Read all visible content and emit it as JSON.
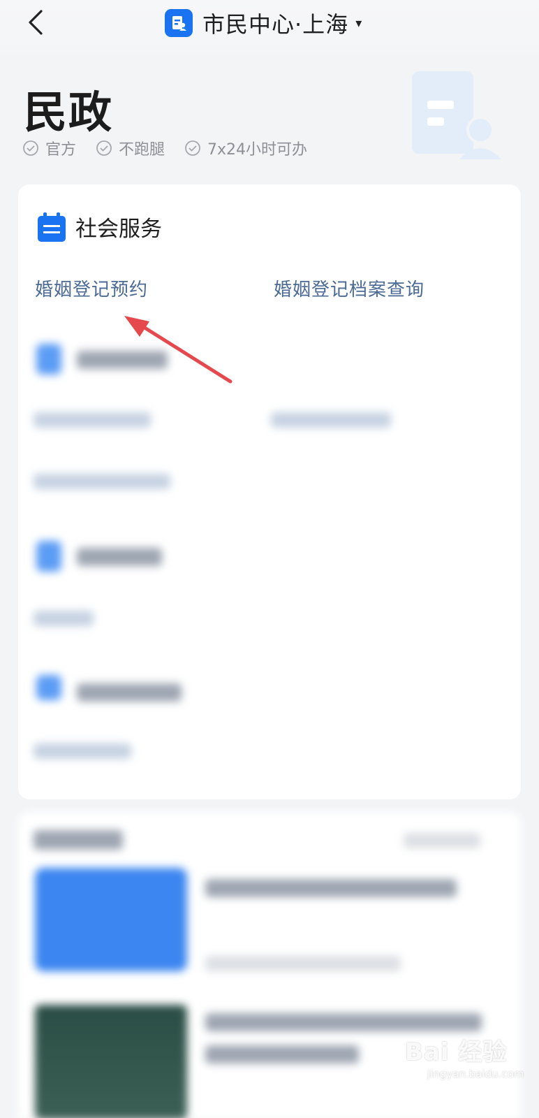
{
  "header": {
    "title": "市民中心·上海",
    "caret": "▾",
    "back_icon": "chevron-left-icon",
    "logo_icon": "citizen-center-icon",
    "logo_color": "#1a73f0"
  },
  "hero": {
    "title": "民政",
    "tags": [
      "官方",
      "不跑腿",
      "7x24小时可办"
    ]
  },
  "section": {
    "title": "社会服务",
    "icon": "calendar-icon",
    "links": [
      "婚姻登记预约",
      "婚姻登记档案查询"
    ],
    "link_color": "#4a6a95"
  },
  "annotation": {
    "arrow_color": "#e5484d"
  },
  "watermark": {
    "brand": "Bai 经验",
    "url": "jingyan.baidu.com"
  }
}
